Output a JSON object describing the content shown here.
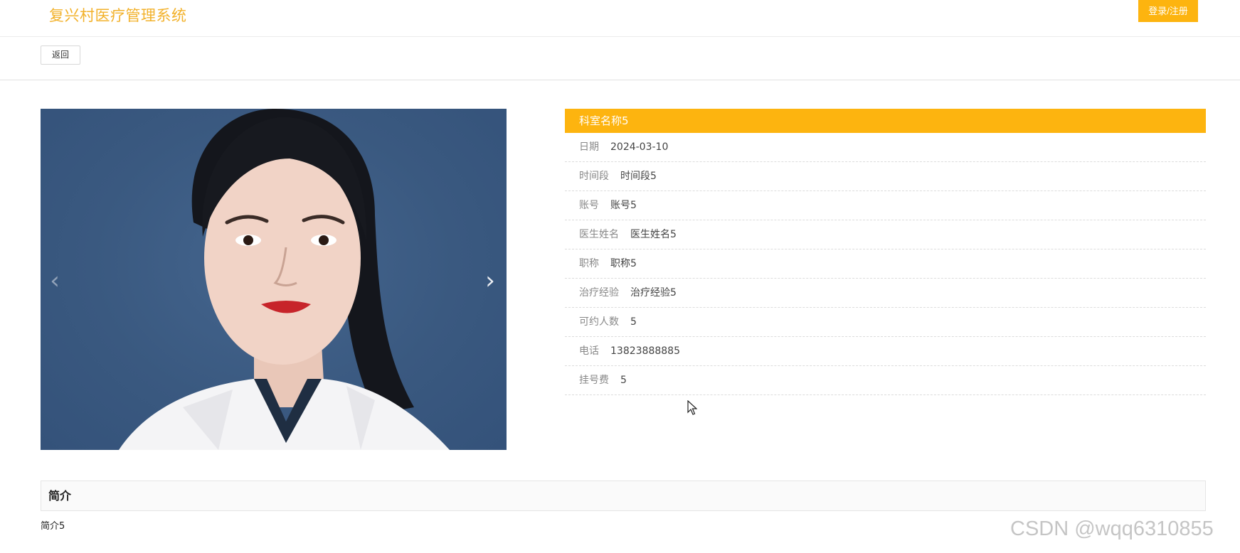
{
  "header": {
    "brand": "复兴村医疗管理系统",
    "login_label": "登录/注册"
  },
  "toolbar": {
    "back_label": "返回"
  },
  "carousel": {
    "prev_icon": "chevron-left-icon",
    "next_icon": "chevron-right-icon",
    "prev_glyph": "‹",
    "next_glyph": "›"
  },
  "detail": {
    "title": "科室名称5",
    "rows": [
      {
        "label": "日期",
        "value": "2024-03-10"
      },
      {
        "label": "时间段",
        "value": "时间段5"
      },
      {
        "label": "账号",
        "value": "账号5"
      },
      {
        "label": "医生姓名",
        "value": "医生姓名5"
      },
      {
        "label": "职称",
        "value": "职称5"
      },
      {
        "label": "治疗经验",
        "value": "治疗经验5"
      },
      {
        "label": "可约人数",
        "value": "5"
      },
      {
        "label": "电话",
        "value": "13823888885"
      },
      {
        "label": "挂号费",
        "value": "5"
      }
    ]
  },
  "intro": {
    "heading": "简介",
    "text": "简介5"
  },
  "watermark": "CSDN @wqq6310855",
  "colors": {
    "accent": "#fdb40f",
    "brand": "#f2b12a",
    "photo_bg": "#3b5a82"
  }
}
